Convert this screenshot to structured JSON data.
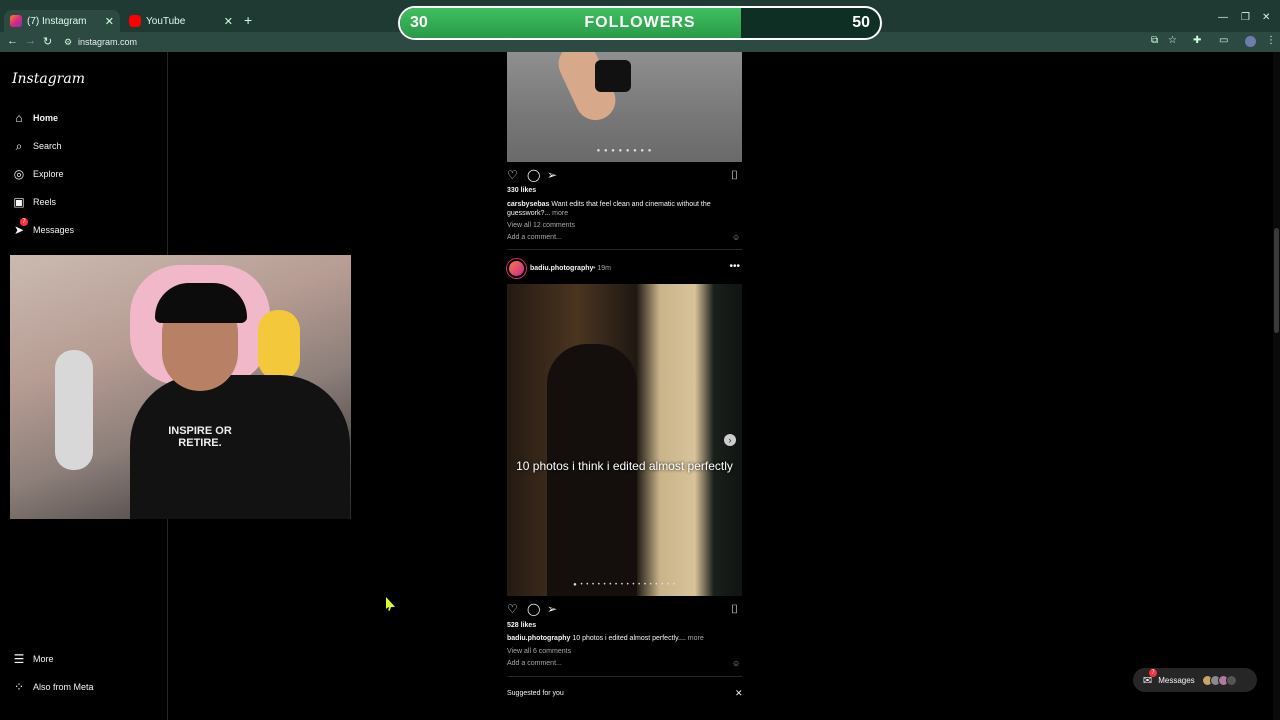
{
  "browser": {
    "tabs": [
      {
        "title": "(7) Instagram",
        "active": true
      },
      {
        "title": "YouTube",
        "active": false
      }
    ],
    "new_tab_icon": "plus-icon",
    "url": "instagram.com"
  },
  "followers_widget": {
    "current": "30",
    "label": "FOLLOWERS",
    "goal": "50",
    "progress": 0.71,
    "color": "#2fa84f"
  },
  "sidebar": {
    "logo": "Instagram",
    "items": [
      {
        "label": "Home",
        "icon": "home-icon",
        "active": true
      },
      {
        "label": "Search",
        "icon": "search-icon"
      },
      {
        "label": "Explore",
        "icon": "compass-icon"
      },
      {
        "label": "Reels",
        "icon": "reels-icon"
      },
      {
        "label": "Messages",
        "icon": "messenger-icon",
        "badge": "7"
      }
    ],
    "bottom": [
      {
        "label": "More",
        "icon": "menu-icon"
      },
      {
        "label": "Also from Meta",
        "icon": "meta-icon"
      }
    ]
  },
  "webcam": {
    "shirt_text": "INSPIRE OR RETIRE."
  },
  "posts": [
    {
      "likes": "330 likes",
      "username": "carsbysebas",
      "caption": "Want edits that feel clean and cinematic without the guesswork?...",
      "more": "more",
      "comments": "View all 12 comments",
      "add_comment": "Add a comment..."
    },
    {
      "username": "badiu.photography",
      "time": "• 19m",
      "overlay_text": "10 photos i think i edited almost perfectly",
      "likes": "528 likes",
      "caption": "10 photos i edited almost perfectly....",
      "more": "more",
      "comments": "View all 6 comments",
      "add_comment": "Add a comment..."
    }
  ],
  "suggested": {
    "title": "Suggested for you"
  },
  "messages_pill": {
    "label": "Messages",
    "badge": "7"
  },
  "colors": {
    "background": "#000000",
    "tab_bar": "#1f3a33",
    "notification": "#ff3040"
  }
}
